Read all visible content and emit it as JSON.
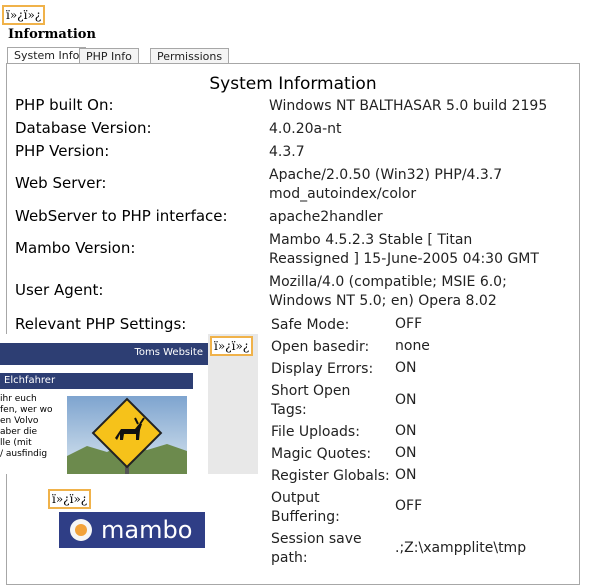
{
  "top_label": "ï»¿ï»¿",
  "heading": "Information",
  "tabs": [
    "System Info",
    "PHP Info",
    "Permissions"
  ],
  "panel_title": "System Information",
  "rows": [
    {
      "label": "PHP built On:",
      "value": "Windows NT BALTHASAR 5.0 build 2195"
    },
    {
      "label": "Database Version:",
      "value": "4.0.20a-nt"
    },
    {
      "label": "PHP Version:",
      "value": "4.3.7"
    },
    {
      "label": "Web Server:",
      "value": "Apache/2.0.50 (Win32) PHP/4.3.7",
      "value2": "mod_autoindex/color"
    },
    {
      "label": "WebServer to PHP interface:",
      "value": "apache2handler"
    },
    {
      "label": "Mambo Version:",
      "value": "Mambo 4.5.2.3 Stable [ Titan",
      "value2": "Reassigned ] 15-June-2005 04:30 GMT"
    },
    {
      "label": "User Agent:",
      "value": "Mozilla/4.0 (compatible; MSIE 6.0;",
      "value2": "Windows NT 5.0; en) Opera 8.02"
    },
    {
      "label": "Relevant PHP Settings:"
    }
  ],
  "settings": [
    {
      "name": "Safe Mode:",
      "value": "OFF"
    },
    {
      "name": "Open basedir:",
      "value": "none"
    },
    {
      "name": "Display Errors:",
      "value": "ON"
    },
    {
      "name": "Short Open",
      "name2": "Tags:",
      "value": "ON"
    },
    {
      "name": "File Uploads:",
      "value": "ON"
    },
    {
      "name": "Magic Quotes:",
      "value": "ON"
    },
    {
      "name": "Register Globals:",
      "value": "ON"
    },
    {
      "name": "Output",
      "name2": "Buffering:",
      "value": "OFF"
    },
    {
      "name": "Session save",
      "name2": "path:",
      "value": ".;Z:\\xampplite\\tmp"
    }
  ],
  "overlay": {
    "site_title": "Toms Website",
    "side_label": "ï»¿ï»¿",
    "section_title": "Elchfahrer",
    "body_lines": [
      "ihr euch",
      "fen, wer wo",
      "en Volvo",
      "aber die",
      "lle (mit",
      "/ ausfindig"
    ],
    "image_icon": "moose-warning-sign-icon"
  },
  "mambo_label": "ï»¿ï»¿",
  "mambo_logo_text": "mambo",
  "colors": {
    "accent_border": "#f0b24a",
    "navy": "#2d3e73",
    "mambo_blue": "#2f3e86"
  }
}
